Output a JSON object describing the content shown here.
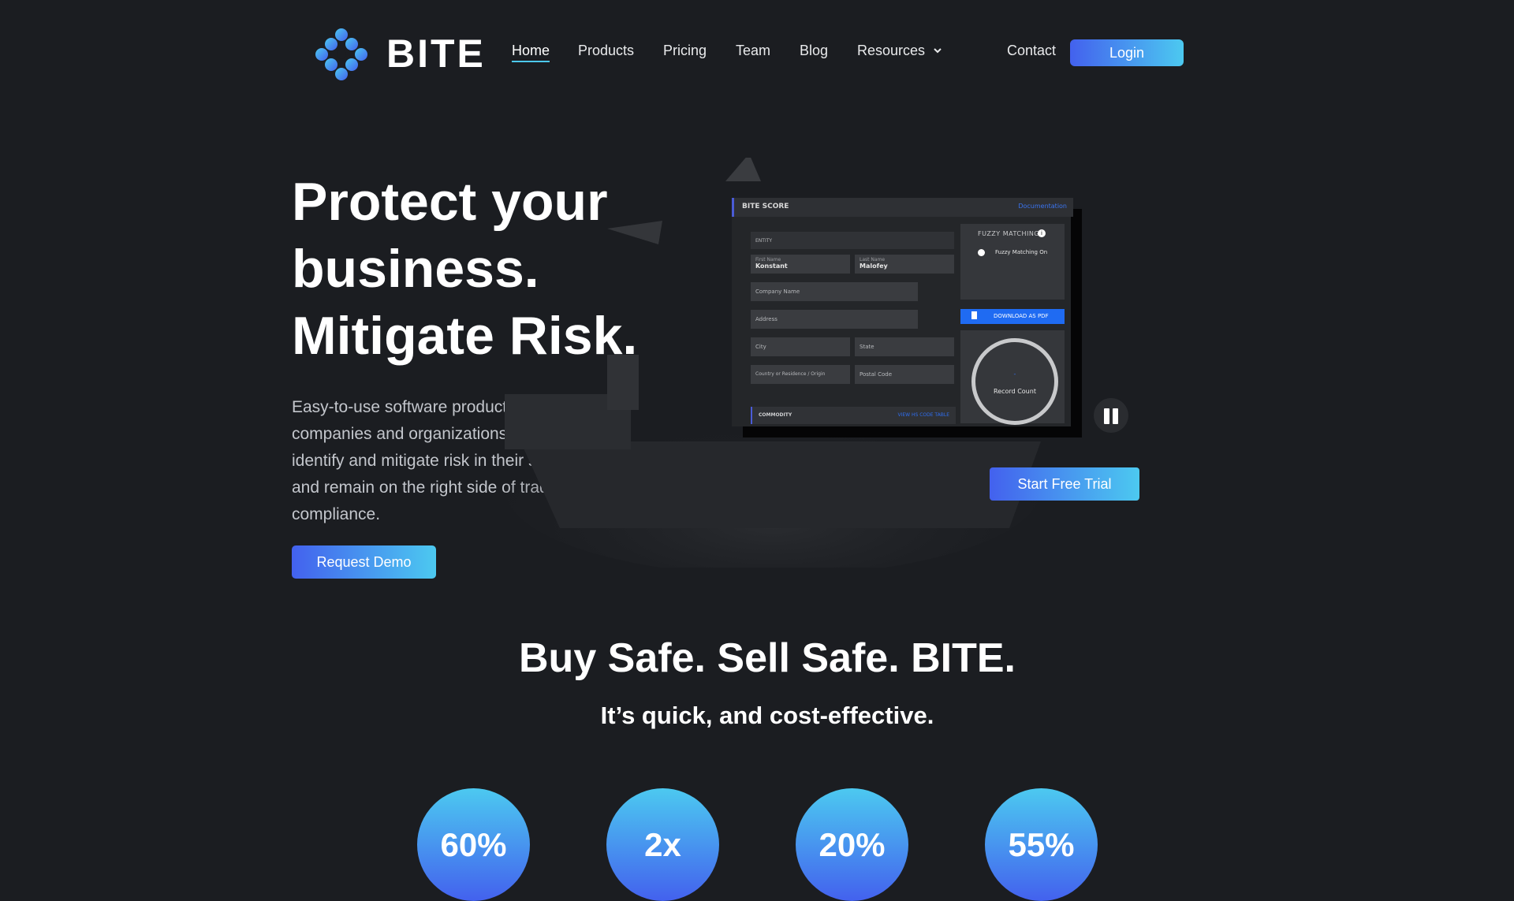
{
  "brand": {
    "name": "BITE",
    "accent_start": "#4361ee",
    "accent_end": "#4cc9f0",
    "background": "#1b1d21"
  },
  "nav": {
    "items": [
      "Home",
      "Products",
      "Pricing",
      "Team",
      "Blog",
      "Resources"
    ],
    "active": "Home",
    "contact": "Contact",
    "login": "Login"
  },
  "hero": {
    "title_lines": [
      "Protect your",
      "business.",
      "Mitigate Risk."
    ],
    "description": "Easy-to-use software products that allow companies and organizations to monitor, identify and mitigate risk in their supply chain, and remain on the right side of trade compliance.",
    "cta": "Request Demo",
    "trial": "Start Free Trial"
  },
  "preview": {
    "header": "BITE SCORE",
    "documentation": "Documentation",
    "entity": "ENTITY",
    "first_name_label": "First Name",
    "first_name": "Konstant",
    "last_name_label": "Last Name",
    "last_name": "Malofey",
    "company": "Company Name",
    "address": "Address",
    "city": "City",
    "state": "State",
    "country": "Country or Residence / Origin",
    "postal": "Postal Code",
    "commodity": "COMMODITY",
    "view_code_table": "VIEW HS CODE TABLE",
    "fuzzy_title": "FUZZY MATCHING",
    "fuzzy_on": "Fuzzy Matching On",
    "download": "DOWNLOAD AS PDF",
    "record_count_value": "-",
    "record_count": "Record Count"
  },
  "tagline": "Buy Safe. Sell Safe. BITE.",
  "subtagline": "It’s quick, and cost-effective.",
  "stats": [
    "60%",
    "2x",
    "20%",
    "55%"
  ]
}
